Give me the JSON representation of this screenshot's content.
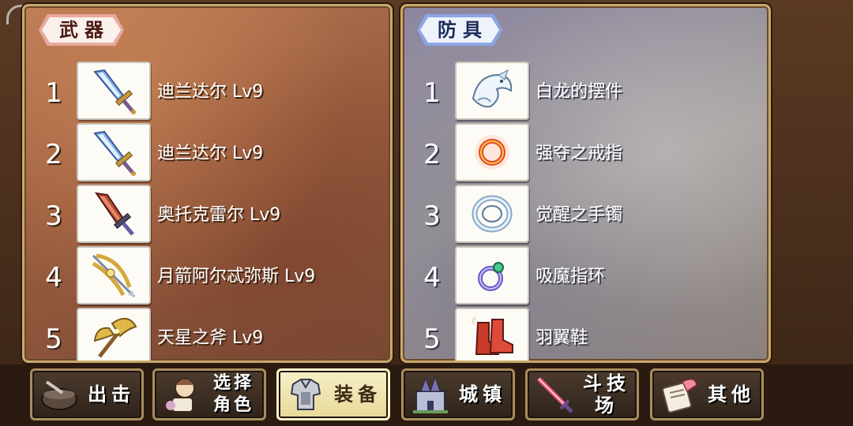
{
  "weapons": {
    "title": "武器",
    "items": [
      {
        "num": "1",
        "name": "迪兰达尔 Lv9",
        "icon": "blue-sword-icon"
      },
      {
        "num": "2",
        "name": "迪兰达尔 Lv9",
        "icon": "blue-sword-icon"
      },
      {
        "num": "3",
        "name": "奥托克雷尔 Lv9",
        "icon": "red-sword-icon"
      },
      {
        "num": "4",
        "name": "月箭阿尔忒弥斯 Lv9",
        "icon": "golden-bow-icon"
      },
      {
        "num": "5",
        "name": "天星之斧 Lv9",
        "icon": "golden-axe-icon"
      }
    ]
  },
  "armor": {
    "title": "防具",
    "items": [
      {
        "num": "1",
        "name": "白龙的摆件",
        "icon": "white-dragon-icon"
      },
      {
        "num": "2",
        "name": "强夺之戒指",
        "icon": "red-ring-icon"
      },
      {
        "num": "3",
        "name": "觉醒之手镯",
        "icon": "bracelet-icon"
      },
      {
        "num": "4",
        "name": "吸魔指环",
        "icon": "purple-ring-icon"
      },
      {
        "num": "5",
        "name": "羽翼鞋",
        "icon": "red-boots-icon"
      }
    ]
  },
  "nav": {
    "sortie": "出击",
    "select_line1": "选择",
    "select_line2": "角色",
    "equip": "装备",
    "town": "城镇",
    "arena": "斗技场",
    "other": "其他"
  },
  "colors": {
    "weapon_panel": "#9a5c3e",
    "armor_panel": "#a59f9a",
    "frame_gold": "#c9a86a",
    "active_button": "#f6efc8"
  }
}
